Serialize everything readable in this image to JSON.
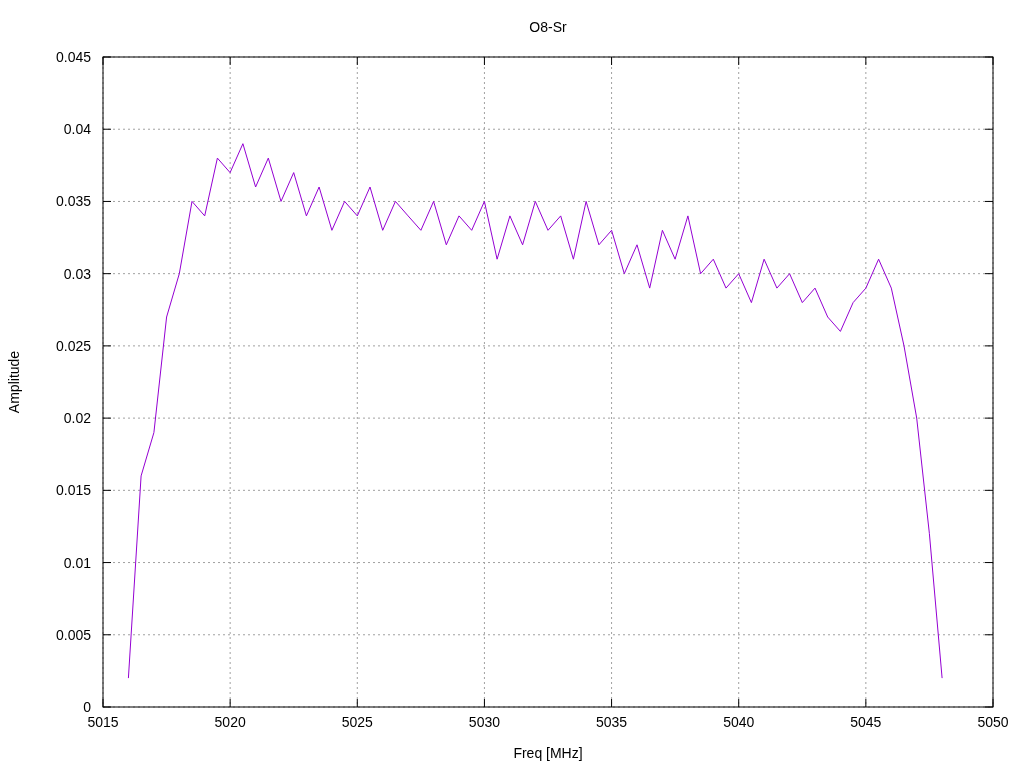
{
  "chart_data": {
    "type": "line",
    "title": "O8-Sr",
    "xlabel": "Freq [MHz]",
    "ylabel": "Amplitude",
    "grid": true,
    "xlim": [
      5015,
      5050
    ],
    "ylim": [
      0,
      0.045
    ],
    "xticks": [
      5015,
      5020,
      5025,
      5030,
      5035,
      5040,
      5045,
      5050
    ],
    "yticks": [
      0,
      0.005,
      0.01,
      0.015,
      0.02,
      0.025,
      0.03,
      0.035,
      0.04,
      0.045
    ],
    "x": [
      5016,
      5016.5,
      5017,
      5017.5,
      5018,
      5018.5,
      5019,
      5019.5,
      5020,
      5020.5,
      5021,
      5021.5,
      5022,
      5022.5,
      5023,
      5023.5,
      5024,
      5024.5,
      5025,
      5025.5,
      5026,
      5026.5,
      5027,
      5027.5,
      5028,
      5028.5,
      5029,
      5029.5,
      5030,
      5030.5,
      5031,
      5031.5,
      5032,
      5032.5,
      5033,
      5033.5,
      5034,
      5034.5,
      5035,
      5035.5,
      5036,
      5036.5,
      5037,
      5037.5,
      5038,
      5038.5,
      5039,
      5039.5,
      5040,
      5040.5,
      5041,
      5041.5,
      5042,
      5042.5,
      5043,
      5043.5,
      5044,
      5044.5,
      5045,
      5045.5,
      5046,
      5046.5,
      5047,
      5047.5,
      5048
    ],
    "series": [
      {
        "color": "#9400d3",
        "values": [
          0.002,
          0.016,
          0.019,
          0.027,
          0.03,
          0.035,
          0.034,
          0.038,
          0.037,
          0.039,
          0.036,
          0.038,
          0.035,
          0.037,
          0.034,
          0.036,
          0.033,
          0.035,
          0.034,
          0.036,
          0.033,
          0.035,
          0.034,
          0.033,
          0.035,
          0.032,
          0.034,
          0.033,
          0.035,
          0.031,
          0.034,
          0.032,
          0.035,
          0.033,
          0.034,
          0.031,
          0.035,
          0.032,
          0.033,
          0.03,
          0.032,
          0.029,
          0.033,
          0.031,
          0.034,
          0.03,
          0.031,
          0.029,
          0.03,
          0.028,
          0.031,
          0.029,
          0.03,
          0.028,
          0.029,
          0.027,
          0.026,
          0.028,
          0.029,
          0.031,
          0.029,
          0.025,
          0.02,
          0.012,
          0.002
        ]
      }
    ]
  }
}
